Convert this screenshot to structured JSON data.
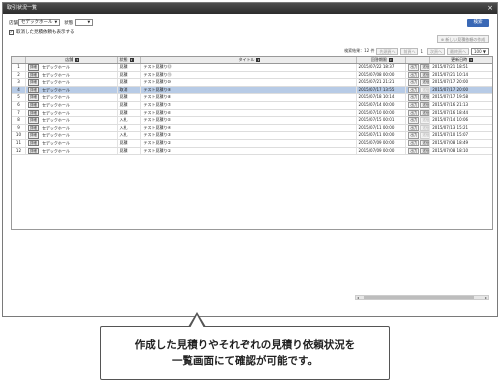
{
  "window": {
    "title": "取引状況一覧",
    "close_glyph": "×"
  },
  "filters": {
    "store_label": "店舗",
    "store_value": "セデックホール",
    "status_label": "状態",
    "status_value": "",
    "show_cancelled_label": "取消した見積依頼も表示する",
    "show_cancelled_checked": true
  },
  "toolbar": {
    "search_label": "検索",
    "new_quote_label": "新しい見積依頼の作成"
  },
  "pager": {
    "result_label": "検索結果：12 件",
    "first_label": "先頭頁へ",
    "prev_label": "前頁へ",
    "page_number": "1",
    "next_label": "次頁へ",
    "last_label": "最終頁へ",
    "page_size": "100"
  },
  "grid": {
    "columns": [
      "",
      "店舗",
      "状態",
      "タイトル",
      "回答期限",
      "",
      "更新日時"
    ],
    "rows": [
      {
        "no": "1",
        "detail": "詳細",
        "store": "セデックホール",
        "status": "見積",
        "title": "テスト見積り⑫",
        "deadline": "2015/07/22 18:37",
        "out": "出力",
        "send": "送信",
        "send_enabled": true,
        "updated": "2015/07/21 18:51",
        "selected": false
      },
      {
        "no": "2",
        "detail": "詳細",
        "store": "セデックホール",
        "status": "見積",
        "title": "テスト見積り⑪",
        "deadline": "2015/07/08 00:00",
        "out": "出力",
        "send": "送信",
        "send_enabled": true,
        "updated": "2015/07/21 10:14",
        "selected": false
      },
      {
        "no": "3",
        "detail": "詳細",
        "store": "セデックホール",
        "status": "見積",
        "title": "テスト見積り⑩",
        "deadline": "2015/07/21 21:21",
        "out": "出力",
        "send": "送信",
        "send_enabled": true,
        "updated": "2015/07/17 20:00",
        "selected": false
      },
      {
        "no": "4",
        "detail": "詳細",
        "store": "セデックホール",
        "status": "取消",
        "title": "テスト見積り⑨",
        "deadline": "2015/07/17 13:55",
        "out": "出力",
        "send": "送信",
        "send_enabled": false,
        "updated": "2015/07/17 20:00",
        "selected": true
      },
      {
        "no": "5",
        "detail": "詳細",
        "store": "セデックホール",
        "status": "見積",
        "title": "テスト見積り⑧",
        "deadline": "2015/07/18 10:14",
        "out": "出力",
        "send": "送信",
        "send_enabled": true,
        "updated": "2015/07/17 19:58",
        "selected": false
      },
      {
        "no": "6",
        "detail": "詳細",
        "store": "セデックホール",
        "status": "見積",
        "title": "テスト見積り⑦",
        "deadline": "2015/07/14 00:00",
        "out": "出力",
        "send": "送信",
        "send_enabled": true,
        "updated": "2015/07/16 21:13",
        "selected": false
      },
      {
        "no": "7",
        "detail": "詳細",
        "store": "セデックホール",
        "status": "見積",
        "title": "テスト見積り⑥",
        "deadline": "2015/07/10 00:00",
        "out": "出力",
        "send": "送信",
        "send_enabled": true,
        "updated": "2015/07/16 18:44",
        "selected": false
      },
      {
        "no": "8",
        "detail": "詳細",
        "store": "セデックホール",
        "status": "入札",
        "title": "テスト見積り⑤",
        "deadline": "2015/07/15 00:01",
        "out": "出力",
        "send": "送信",
        "send_enabled": false,
        "updated": "2015/07/14 10:06",
        "selected": false
      },
      {
        "no": "9",
        "detail": "詳細",
        "store": "セデックホール",
        "status": "入札",
        "title": "テスト見積り④",
        "deadline": "2015/07/11 00:00",
        "out": "出力",
        "send": "送信",
        "send_enabled": false,
        "updated": "2015/07/13 15:21",
        "selected": false
      },
      {
        "no": "10",
        "detail": "詳細",
        "store": "セデックホール",
        "status": "入札",
        "title": "テスト見積り③",
        "deadline": "2015/07/11 00:00",
        "out": "出力",
        "send": "送信",
        "send_enabled": false,
        "updated": "2015/07/10 15:07",
        "selected": false
      },
      {
        "no": "11",
        "detail": "詳細",
        "store": "セデックホール",
        "status": "見積",
        "title": "テスト見積り②",
        "deadline": "2015/07/09 00:00",
        "out": "出力",
        "send": "送信",
        "send_enabled": true,
        "updated": "2015/07/08 18:49",
        "selected": false
      },
      {
        "no": "12",
        "detail": "詳細",
        "store": "セデックホール",
        "status": "見積",
        "title": "テスト見積り①",
        "deadline": "2015/07/09 00:00",
        "out": "出力",
        "send": "送信",
        "send_enabled": true,
        "updated": "2015/07/08 18:10",
        "selected": false
      }
    ]
  },
  "callout": {
    "line1": "作成した見積りやそれぞれの見積り依頼状況を",
    "line2": "一覧画面にて確認が可能です。"
  },
  "colors": {
    "accent": "#3a68b5",
    "selected_row": "#b7cbe6",
    "titlebar": "#3a3a3a"
  }
}
